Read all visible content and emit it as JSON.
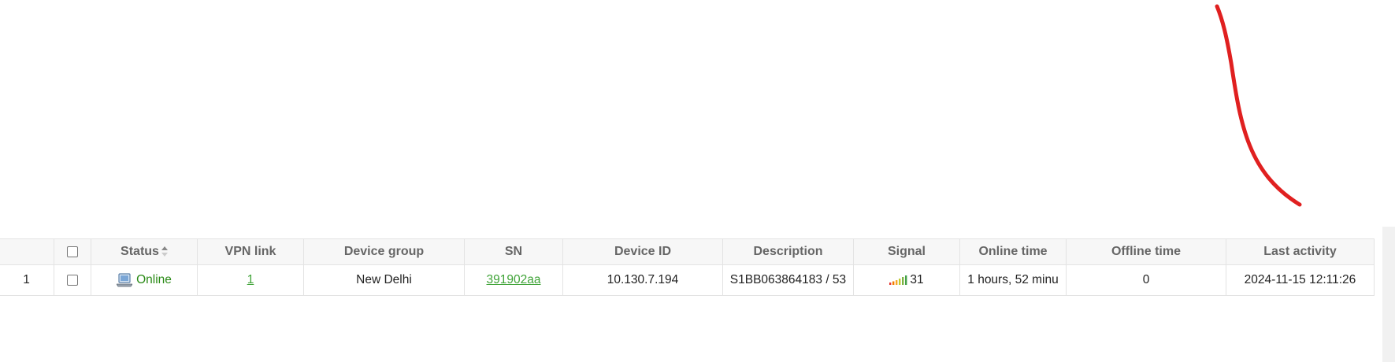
{
  "table": {
    "columns": {
      "status": "Status",
      "vpn_link": "VPN link",
      "device_group": "Device group",
      "sn": "SN",
      "device_id": "Device ID",
      "description": "Description",
      "signal": "Signal",
      "online_time": "Online time",
      "offline_time": "Offline time",
      "last_activity": "Last activity"
    },
    "rows": [
      {
        "index": "1",
        "status": "Online",
        "vpn_link": "1",
        "device_group": "New Delhi",
        "sn": "391902aa",
        "device_id": "10.130.7.194",
        "description": "S1BB063864183 / 53",
        "signal": "31",
        "online_time": "1 hours, 52 minu",
        "offline_time": "0",
        "last_activity": "2024-11-15 12:11:26"
      }
    ]
  },
  "colors": {
    "online_text": "#2a8a16",
    "link": "#3fa337",
    "annotation_arrow": "#e02020"
  },
  "icons": {
    "status": "laptop-icon",
    "sort": "sort-icon",
    "signal": "signal-bars-icon"
  }
}
